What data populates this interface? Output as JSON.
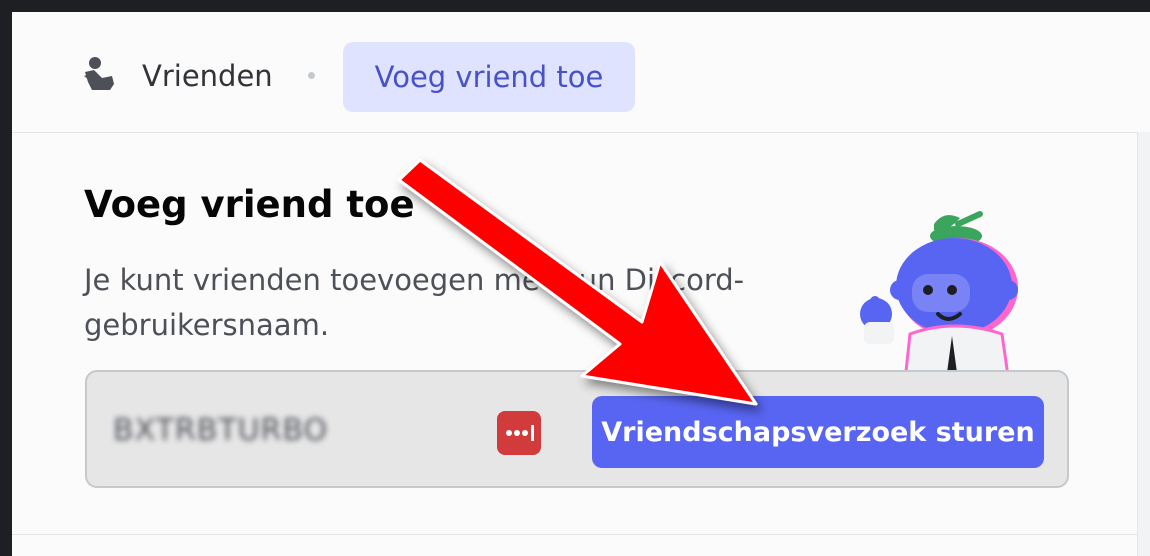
{
  "topbar": {
    "friends_label": "Vrienden",
    "friends_icon": "friends-icon",
    "tab_add_friend": "Voeg vriend toe"
  },
  "main": {
    "title": "Voeg vriend toe",
    "description": "Je kunt vrienden toevoegen met hun Discord-gebruikersnaam.",
    "username_value": "BXTRBTURBO",
    "password_manager_icon": "lastpass-icon",
    "send_button_label": "Vriendschapsverzoek sturen"
  },
  "colors": {
    "accent": "#5865f2",
    "tab_active_bg": "#e0e3ff",
    "annotation_arrow": "#ff0000"
  }
}
